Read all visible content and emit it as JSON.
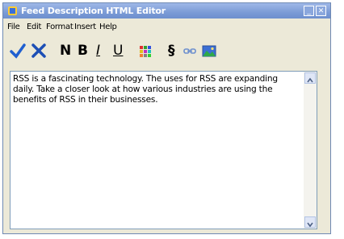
{
  "window": {
    "title": "Feed Description HTML Editor"
  },
  "menu": [
    "File",
    "Edit",
    "Format",
    "Insert",
    "Help"
  ],
  "toolbar": {
    "normal_label": "N",
    "bold_label": "B",
    "italic_label": "I",
    "underline_label": "U",
    "section_label": "§"
  },
  "editor": {
    "text": "RSS is a fascinating technology. The uses for RSS are expanding daily. Take a closer look at how various industries are using the benefits of RSS in their businesses."
  },
  "colors": {
    "accept": "#1f5fd0",
    "reject": "#1d4fb5",
    "titlebar": "#7b9bd6",
    "editor_border": "#7f9db9"
  }
}
